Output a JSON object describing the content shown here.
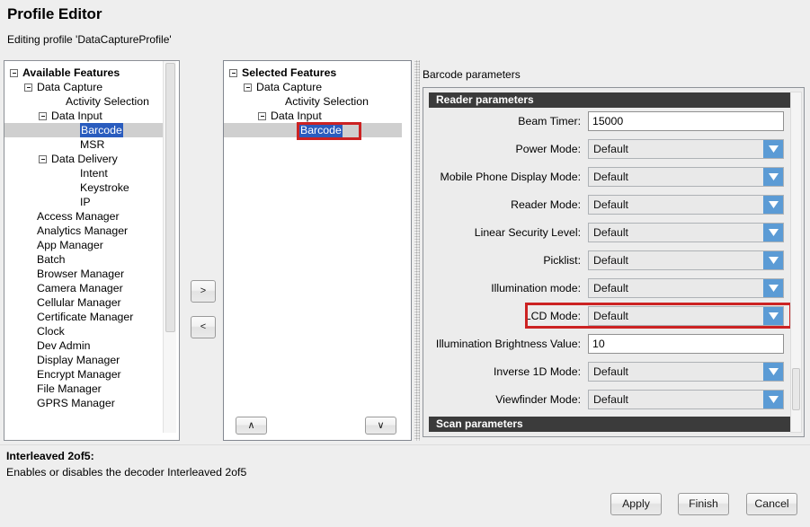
{
  "window": {
    "title": "Profile Editor",
    "subtitle": "Editing profile 'DataCaptureProfile'"
  },
  "available_features": {
    "header": "Available Features",
    "items": [
      {
        "label": "Available Features",
        "depth": 0,
        "twisty": true,
        "bold": true,
        "selected": false
      },
      {
        "label": "Data Capture",
        "depth": 1,
        "twisty": true,
        "bold": false,
        "selected": false
      },
      {
        "label": "Activity Selection",
        "depth": 3,
        "twisty": false,
        "bold": false,
        "selected": false
      },
      {
        "label": "Data Input",
        "depth": 2,
        "twisty": true,
        "bold": false,
        "selected": false
      },
      {
        "label": "Barcode",
        "depth": 4,
        "twisty": false,
        "bold": false,
        "selected": true
      },
      {
        "label": "MSR",
        "depth": 4,
        "twisty": false,
        "bold": false,
        "selected": false
      },
      {
        "label": "Data Delivery",
        "depth": 2,
        "twisty": true,
        "bold": false,
        "selected": false
      },
      {
        "label": "Intent",
        "depth": 4,
        "twisty": false,
        "bold": false,
        "selected": false
      },
      {
        "label": "Keystroke",
        "depth": 4,
        "twisty": false,
        "bold": false,
        "selected": false
      },
      {
        "label": "IP",
        "depth": 4,
        "twisty": false,
        "bold": false,
        "selected": false
      },
      {
        "label": "Access Manager",
        "depth": 1,
        "twisty": false,
        "bold": false,
        "selected": false
      },
      {
        "label": "Analytics Manager",
        "depth": 1,
        "twisty": false,
        "bold": false,
        "selected": false
      },
      {
        "label": "App Manager",
        "depth": 1,
        "twisty": false,
        "bold": false,
        "selected": false
      },
      {
        "label": "Batch",
        "depth": 1,
        "twisty": false,
        "bold": false,
        "selected": false
      },
      {
        "label": "Browser Manager",
        "depth": 1,
        "twisty": false,
        "bold": false,
        "selected": false
      },
      {
        "label": "Camera Manager",
        "depth": 1,
        "twisty": false,
        "bold": false,
        "selected": false
      },
      {
        "label": "Cellular Manager",
        "depth": 1,
        "twisty": false,
        "bold": false,
        "selected": false
      },
      {
        "label": "Certificate Manager",
        "depth": 1,
        "twisty": false,
        "bold": false,
        "selected": false
      },
      {
        "label": "Clock",
        "depth": 1,
        "twisty": false,
        "bold": false,
        "selected": false
      },
      {
        "label": "Dev Admin",
        "depth": 1,
        "twisty": false,
        "bold": false,
        "selected": false
      },
      {
        "label": "Display Manager",
        "depth": 1,
        "twisty": false,
        "bold": false,
        "selected": false
      },
      {
        "label": "Encrypt Manager",
        "depth": 1,
        "twisty": false,
        "bold": false,
        "selected": false
      },
      {
        "label": "File Manager",
        "depth": 1,
        "twisty": false,
        "bold": false,
        "selected": false
      },
      {
        "label": "GPRS Manager",
        "depth": 1,
        "twisty": false,
        "bold": false,
        "selected": false
      }
    ]
  },
  "selected_features": {
    "header": "Selected Features",
    "items": [
      {
        "label": "Selected Features",
        "depth": 0,
        "twisty": true,
        "bold": true,
        "selected": false
      },
      {
        "label": "Data Capture",
        "depth": 1,
        "twisty": true,
        "bold": false,
        "selected": false
      },
      {
        "label": "Activity Selection",
        "depth": 3,
        "twisty": false,
        "bold": false,
        "selected": false
      },
      {
        "label": "Data Input",
        "depth": 2,
        "twisty": true,
        "bold": false,
        "selected": false
      },
      {
        "label": "Barcode",
        "depth": 4,
        "twisty": false,
        "bold": false,
        "selected": true
      }
    ]
  },
  "transfer": {
    "add_label": ">",
    "remove_label": "<"
  },
  "reorder": {
    "up_label": "∧",
    "down_label": "∨"
  },
  "params": {
    "caption": "Barcode parameters",
    "sections": [
      {
        "header": "Reader parameters",
        "fields": [
          {
            "label": "Beam Timer:",
            "type": "text",
            "value": "15000",
            "highlighted": false
          },
          {
            "label": "Power Mode:",
            "type": "combo",
            "value": "Default",
            "highlighted": false
          },
          {
            "label": "Mobile Phone Display Mode:",
            "type": "combo",
            "value": "Default",
            "highlighted": false
          },
          {
            "label": "Reader Mode:",
            "type": "combo",
            "value": "Default",
            "highlighted": false
          },
          {
            "label": "Linear Security Level:",
            "type": "combo",
            "value": "Default",
            "highlighted": false
          },
          {
            "label": "Picklist:",
            "type": "combo",
            "value": "Default",
            "highlighted": false
          },
          {
            "label": "Illumination mode:",
            "type": "combo",
            "value": "Default",
            "highlighted": false
          },
          {
            "label": "LCD Mode:",
            "type": "combo",
            "value": "Default",
            "highlighted": true
          },
          {
            "label": "Illumination Brightness Value:",
            "type": "text",
            "value": "10",
            "highlighted": false
          },
          {
            "label": "Inverse 1D Mode:",
            "type": "combo",
            "value": "Default",
            "highlighted": false
          },
          {
            "label": "Viewfinder Mode:",
            "type": "combo",
            "value": "Default",
            "highlighted": false
          }
        ]
      },
      {
        "header": "Scan parameters",
        "fields": [
          {
            "label": "",
            "type": "combo",
            "value": "",
            "highlighted": false,
            "partial": true
          }
        ]
      }
    ]
  },
  "status": {
    "title": "Interleaved 2of5:",
    "description": "Enables or disables the decoder Interleaved 2of5"
  },
  "footer": {
    "apply_label": "Apply",
    "finish_label": "Finish",
    "cancel_label": "Cancel"
  },
  "colors": {
    "combo_arrow": "#5b9bd5",
    "section_header_bg": "#3b3b3b",
    "selection_blue": "#2a5cbe",
    "annotation_red": "#cc2222",
    "window_bg": "#eeeeee"
  }
}
